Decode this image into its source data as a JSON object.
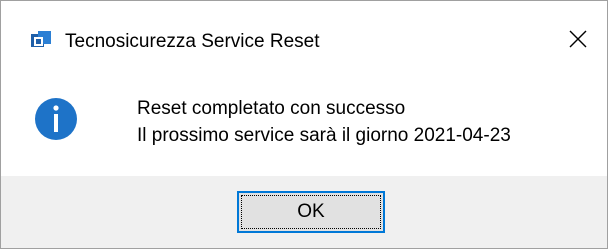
{
  "window": {
    "title": "Tecnosicurezza Service Reset",
    "app_icon": "app-window-icon",
    "close_icon": "close-icon"
  },
  "dialog": {
    "icon": "info-icon",
    "message_line1": "Reset completato con successo",
    "message_line2": "Il prossimo service sarà il giorno 2021-04-23"
  },
  "buttons": {
    "ok_label": "OK"
  },
  "colors": {
    "accent": "#0078d7",
    "info_icon_fill": "#1e73c8",
    "footer_bg": "#f0f0f0",
    "button_bg": "#e1e1e1"
  }
}
